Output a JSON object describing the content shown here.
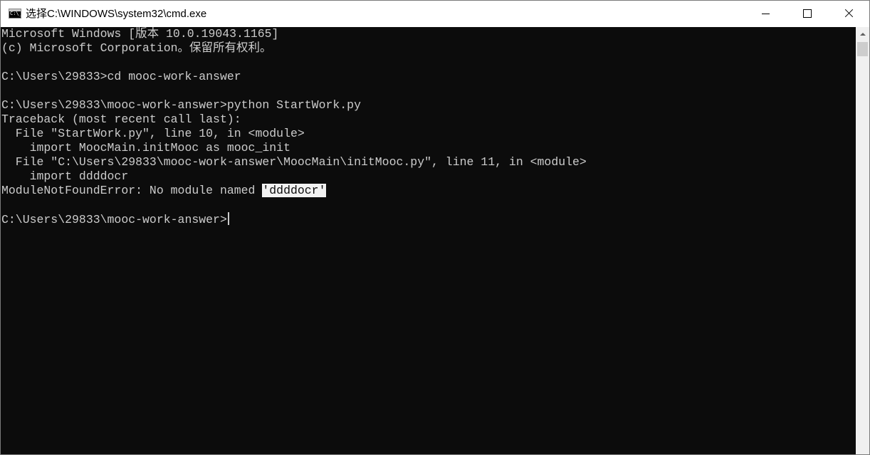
{
  "window": {
    "title": "选择C:\\WINDOWS\\system32\\cmd.exe",
    "icon": "cmd-console-icon",
    "controls": {
      "minimize_icon": "minimize-icon",
      "maximize_icon": "maximize-icon",
      "close_icon": "close-icon"
    }
  },
  "console": {
    "colors": {
      "background": "#0c0c0c",
      "foreground": "#cccccc",
      "selection_background": "#f2f2f2",
      "selection_foreground": "#0c0c0c"
    },
    "lines": [
      "Microsoft Windows [版本 10.0.19043.1165]",
      "(c) Microsoft Corporation。保留所有权利。",
      "",
      "C:\\Users\\29833>cd mooc-work-answer",
      "",
      "C:\\Users\\29833\\mooc-work-answer>python StartWork.py",
      "Traceback (most recent call last):",
      "  File \"StartWork.py\", line 10, in <module>",
      "    import MoocMain.initMooc as mooc_init",
      "  File \"C:\\Users\\29833\\mooc-work-answer\\MoocMain\\initMooc.py\", line 11, in <module>",
      "    import ddddocr"
    ],
    "error_line": {
      "prefix": "ModuleNotFoundError: No module named ",
      "selected": "'ddddocr'"
    },
    "prompt": "C:\\Users\\29833\\mooc-work-answer>"
  },
  "scrollbar": {
    "up_arrow_icon": "scroll-up-arrow-icon"
  }
}
